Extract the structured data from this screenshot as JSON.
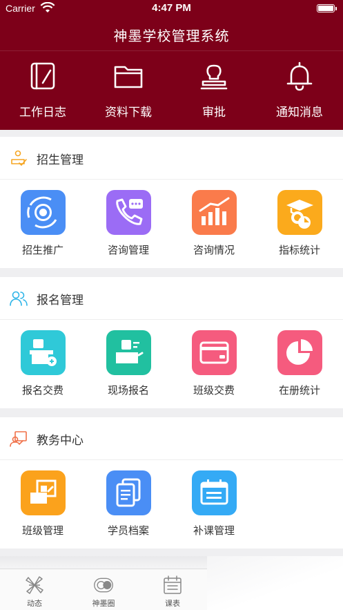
{
  "status_bar": {
    "carrier": "Carrier",
    "time": "4:47 PM"
  },
  "header": {
    "title": "神墨学校管理系统",
    "shortcuts": [
      {
        "label": "工作日志",
        "icon": "notebook-icon"
      },
      {
        "label": "资料下载",
        "icon": "folder-icon"
      },
      {
        "label": "审批",
        "icon": "stamp-icon"
      },
      {
        "label": "通知消息",
        "icon": "bell-icon"
      }
    ]
  },
  "sections": [
    {
      "title": "招生管理",
      "icon": "enrollment-icon",
      "items": [
        {
          "label": "招生推广",
          "icon": "radar-icon",
          "color": "#4a8ef5"
        },
        {
          "label": "咨询管理",
          "icon": "phone-chat-icon",
          "color": "#9b6cf5"
        },
        {
          "label": "咨询情况",
          "icon": "bar-chart-icon",
          "color": "#fa7b4b"
        },
        {
          "label": "指标统计",
          "icon": "graduate-icon",
          "color": "#fbaa1c"
        }
      ]
    },
    {
      "title": "报名管理",
      "icon": "users-icon",
      "items": [
        {
          "label": "报名交费",
          "icon": "pay-desk-icon",
          "color": "#2fc9d8"
        },
        {
          "label": "现场报名",
          "icon": "onsite-desk-icon",
          "color": "#21c0a0"
        },
        {
          "label": "班级交费",
          "icon": "card-icon",
          "color": "#f55b7e"
        },
        {
          "label": "在册统计",
          "icon": "pie-chart-icon",
          "color": "#f55b7e"
        }
      ]
    },
    {
      "title": "教务中心",
      "icon": "teaching-icon",
      "items": [
        {
          "label": "班级管理",
          "icon": "classroom-icon",
          "color": "#fba21c"
        },
        {
          "label": "学员档案",
          "icon": "documents-icon",
          "color": "#4a8ef5"
        },
        {
          "label": "补课管理",
          "icon": "calendar-icon",
          "color": "#34aaf5"
        }
      ]
    }
  ],
  "tabbar": [
    {
      "label": "动态",
      "icon": "pinwheel-icon"
    },
    {
      "label": "神墨圈",
      "icon": "toggle-circle-icon"
    },
    {
      "label": "课表",
      "icon": "schedule-icon"
    }
  ]
}
